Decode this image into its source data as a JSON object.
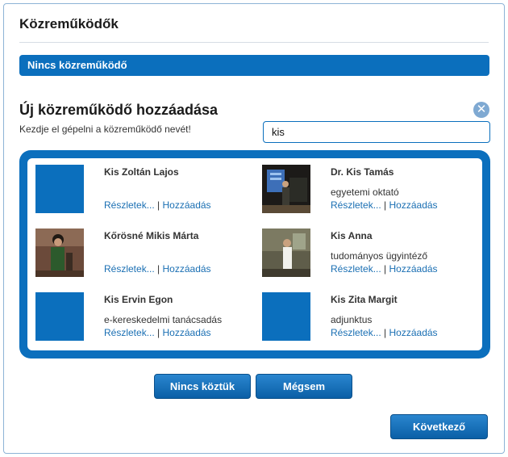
{
  "header": {
    "title": "Közreműködők"
  },
  "status": {
    "empty_label": "Nincs közreműködő"
  },
  "add_section": {
    "heading": "Új közreműködő hozzáadása",
    "hint": "Kezdje el gépelni a közreműködő nevét!",
    "search_value": "kis"
  },
  "results": [
    {
      "name": "Kis Zoltán Lajos",
      "role": "",
      "details": "Részletek...",
      "add": "Hozzáadás",
      "photo": false
    },
    {
      "name": "Dr. Kis Tamás",
      "role": "egyetemi oktató",
      "details": "Részletek...",
      "add": "Hozzáadás",
      "photo": true
    },
    {
      "name": "Kőrösné Mikis Márta",
      "role": "",
      "details": "Részletek...",
      "add": "Hozzáadás",
      "photo": true
    },
    {
      "name": "Kis Anna",
      "role": "tudományos ügyintéző",
      "details": "Részletek...",
      "add": "Hozzáadás",
      "photo": true
    },
    {
      "name": "Kis Ervin Egon",
      "role": "e-kereskedelmi tanácsadás",
      "details": "Részletek...",
      "add": "Hozzáadás",
      "photo": false
    },
    {
      "name": "Kis Zita Margit",
      "role": "adjunktus",
      "details": "Részletek...",
      "add": "Hozzáadás",
      "photo": false
    }
  ],
  "link_separator": "|",
  "buttons": {
    "none_label": "Nincs köztük",
    "cancel_label": "Mégsem",
    "next_label": "Következő"
  },
  "colors": {
    "accent": "#0b6fbd",
    "link": "#1a6fb3"
  }
}
